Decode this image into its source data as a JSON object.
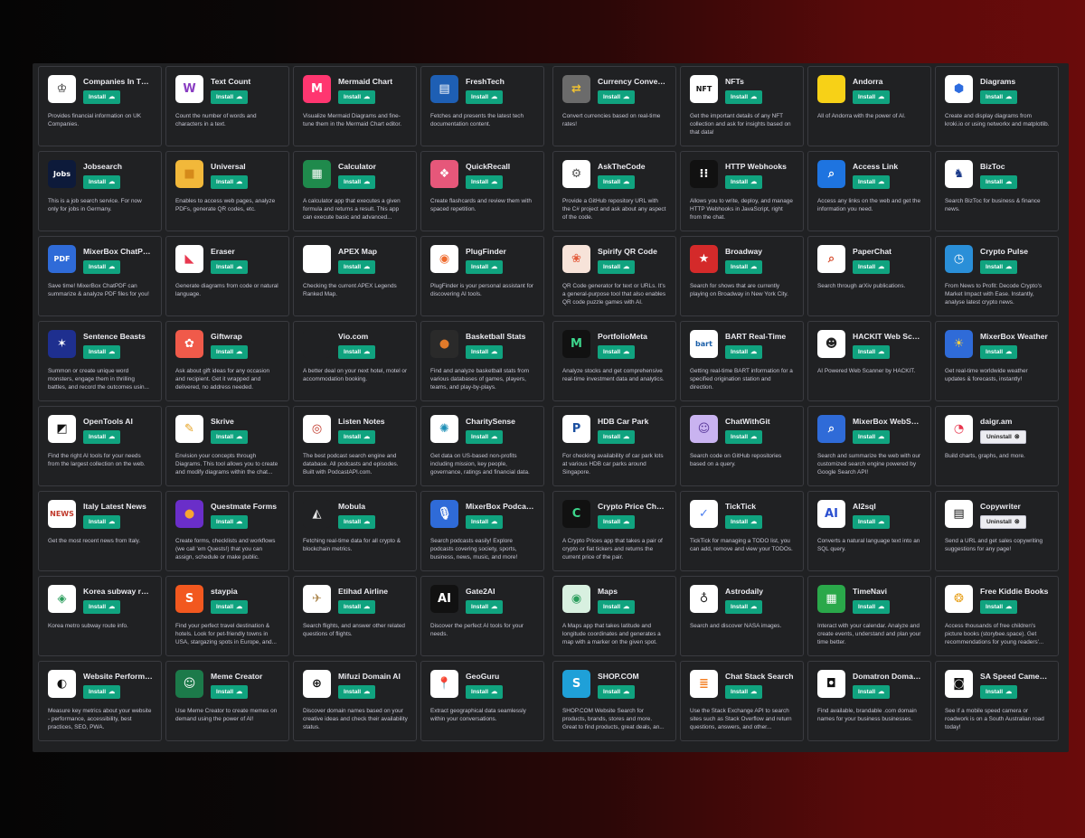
{
  "install_label": "Install",
  "uninstall_label": "Uninstall",
  "left_plugins": [
    {
      "name": "Companies In The ...",
      "desc": "Provides financial information on UK Companies.",
      "icon": "crown-icon",
      "glyph": "♔",
      "bg": "#ffffff",
      "fg": "#222222",
      "action": "install"
    },
    {
      "name": "Text Count",
      "desc": "Count the number of words and characters in a text.",
      "icon": "w-circle-icon",
      "glyph": "W",
      "bg": "#ffffff",
      "fg": "#8a3ec2",
      "action": "install"
    },
    {
      "name": "Mermaid Chart",
      "desc": "Visualize Mermaid Diagrams and fine-tune them in the Mermaid Chart editor.",
      "icon": "mermaid-icon",
      "glyph": "M",
      "bg": "#ff3670",
      "fg": "#ffffff",
      "action": "install"
    },
    {
      "name": "FreshTech",
      "desc": "Fetches and presents the latest tech documentation content.",
      "icon": "book-icon",
      "glyph": "▤",
      "bg": "#1e5fb4",
      "fg": "#ffffff",
      "action": "install"
    },
    {
      "name": "Jobsearch",
      "desc": "This is a job search service. For now only for jobs in Germany.",
      "icon": "jobs-icon",
      "glyph": "Jobs",
      "bg": "#0d1a3a",
      "fg": "#ffffff",
      "action": "install"
    },
    {
      "name": "Universal",
      "desc": "Enables to access web pages, analyze PDFs, generate QR codes, etc.",
      "icon": "cube-icon",
      "glyph": "■",
      "bg": "#f2b83a",
      "fg": "#d58a1a",
      "action": "install"
    },
    {
      "name": "Calculator",
      "desc": "A calculator app that executes a given formula and returns a result. This app can execute basic and advanced...",
      "icon": "calculator-icon",
      "glyph": "▦",
      "bg": "#1f8a4c",
      "fg": "#ffffff",
      "action": "install"
    },
    {
      "name": "QuickRecall",
      "desc": "Create flashcards and review them with spaced repetition.",
      "icon": "flashcard-icon",
      "glyph": "❖",
      "bg": "#e6577a",
      "fg": "#ffffff",
      "action": "install"
    },
    {
      "name": "MixerBox ChatPDF",
      "desc": "Save time! MixerBox ChatPDF can summarize & analyze PDF files for you!",
      "icon": "pdf-icon",
      "glyph": "PDF",
      "bg": "#2f6bd8",
      "fg": "#ffffff",
      "action": "install"
    },
    {
      "name": "Eraser",
      "desc": "Generate diagrams from code or natural language.",
      "icon": "eraser-icon",
      "glyph": "◣",
      "bg": "#ffffff",
      "fg": "#e8384f",
      "action": "install"
    },
    {
      "name": "APEX Map",
      "desc": "Checking the current APEX Legends Ranked Map.",
      "icon": "apex-map-icon",
      "glyph": "",
      "bg": "#ffffff",
      "fg": "#ffffff",
      "action": "install"
    },
    {
      "name": "PlugFinder",
      "desc": "PlugFinder is your personal assistant for discovering AI tools.",
      "icon": "plug-finder-icon",
      "glyph": "◉",
      "bg": "#ffffff",
      "fg": "#ef6c2f",
      "action": "install"
    },
    {
      "name": "Sentence Beasts",
      "desc": "Summon or create unique word monsters, engage them in thrilling battles, and record the outcomes usin...",
      "icon": "beasts-icon",
      "glyph": "✶",
      "bg": "#1e2f8f",
      "fg": "#ffffff",
      "action": "install"
    },
    {
      "name": "Giftwrap",
      "desc": "Ask about gift ideas for any occasion and recipient. Get it wrapped and delivered, no address needed.",
      "icon": "gift-icon",
      "glyph": "✿",
      "bg": "#f05a4a",
      "fg": "#ffffff",
      "action": "install"
    },
    {
      "name": "Vio.com",
      "desc": "A better deal on your next hotel, motel or accommodation booking.",
      "icon": "vio-icon",
      "glyph": "",
      "bg": "#202123",
      "fg": "#ffffff",
      "action": "install"
    },
    {
      "name": "Basketball Stats",
      "desc": "Find and analyze basketball stats from various databases of games, players, teams, and play-by-plays.",
      "icon": "basketball-icon",
      "glyph": "●",
      "bg": "#2a2a2a",
      "fg": "#e07a2a",
      "action": "install"
    },
    {
      "name": "OpenTools AI",
      "desc": "Find the right AI tools for your needs from the largest collection on the web.",
      "icon": "opentools-icon",
      "glyph": "◩",
      "bg": "#ffffff",
      "fg": "#111111",
      "action": "install"
    },
    {
      "name": "Skrive",
      "desc": "Envision your concepts through Diagrams. This tool allows you to create and modify diagrams within the chat...",
      "icon": "pencil-icon",
      "glyph": "✎",
      "bg": "#ffffff",
      "fg": "#e6a11f",
      "action": "install"
    },
    {
      "name": "Listen Notes",
      "desc": "The best podcast search engine and database. All podcasts and episodes. Built with PodcastAPI.com.",
      "icon": "listen-notes-icon",
      "glyph": "◎",
      "bg": "#ffffff",
      "fg": "#c0392b",
      "action": "install"
    },
    {
      "name": "CharitySense",
      "desc": "Get data on US-based non-profits including mission, key people, governance, ratings and financial data.",
      "icon": "charity-icon",
      "glyph": "✺",
      "bg": "#ffffff",
      "fg": "#1e8fb7",
      "action": "install"
    },
    {
      "name": "Italy Latest News",
      "desc": "Get the most recent news from Italy.",
      "icon": "italy-news-icon",
      "glyph": "NEWS",
      "bg": "#ffffff",
      "fg": "#c0392b",
      "action": "install"
    },
    {
      "name": "Questmate Forms",
      "desc": "Create forms, checklists and workflows (we call 'em Quests!) that you can assign, schedule or make public.",
      "icon": "questmate-icon",
      "glyph": "●",
      "bg": "#6a2ec9",
      "fg": "#f7a531",
      "action": "install"
    },
    {
      "name": "Mobula",
      "desc": "Fetching real-time data for all crypto & blockchain metrics.",
      "icon": "mobula-icon",
      "glyph": "◭",
      "bg": "#202123",
      "fg": "#e8e8e8",
      "action": "install"
    },
    {
      "name": "MixerBox Podcasts",
      "desc": "Search podcasts easily! Explore podcasts covering society, sports, business, news, music, and more!",
      "icon": "podcast-icon",
      "glyph": "🎙",
      "bg": "#2f6bd8",
      "fg": "#ffffff",
      "action": "install"
    },
    {
      "name": "Korea subway route",
      "desc": "Korea metro subway route info.",
      "icon": "subway-icon",
      "glyph": "◈",
      "bg": "#ffffff",
      "fg": "#2a9d5c",
      "action": "install"
    },
    {
      "name": "staypia",
      "desc": "Find your perfect travel destination & hotels. Look for pet-friendly towns in USA, stargazing spots in Europe, and...",
      "icon": "staypia-icon",
      "glyph": "S",
      "bg": "#f2581f",
      "fg": "#ffffff",
      "action": "install"
    },
    {
      "name": "Etihad Airline",
      "desc": "Search flights, and answer other related questions of flights.",
      "icon": "etihad-icon",
      "glyph": "✈",
      "bg": "#ffffff",
      "fg": "#b08d57",
      "action": "install"
    },
    {
      "name": "Gate2AI",
      "desc": "Discover the perfect AI tools for your needs.",
      "icon": "gate2ai-icon",
      "glyph": "AI",
      "bg": "#111111",
      "fg": "#ffffff",
      "action": "install"
    },
    {
      "name": "Website Performa...",
      "desc": "Measure key metrics about your website - performance, accessibility, best practices, SEO, PWA.",
      "icon": "speedometer-icon",
      "glyph": "◐",
      "bg": "#ffffff",
      "fg": "#111111",
      "action": "install"
    },
    {
      "name": "Meme Creator",
      "desc": "Use Meme Creator to create memes on demand using the power of AI!",
      "icon": "meme-icon",
      "glyph": "☺",
      "bg": "#1c7a4a",
      "fg": "#ffffff",
      "action": "install"
    },
    {
      "name": "Mifuzi Domain AI",
      "desc": "Discover domain names based on your creative ideas and check their availability status.",
      "icon": "globe-www-icon",
      "glyph": "⊕",
      "bg": "#ffffff",
      "fg": "#111111",
      "action": "install"
    },
    {
      "name": "GeoGuru",
      "desc": "Extract geographical data seamlessly within your conversations.",
      "icon": "pin-icon",
      "glyph": "📍",
      "bg": "#ffffff",
      "fg": "#d0322f",
      "action": "install"
    }
  ],
  "right_plugins": [
    {
      "name": "Currency Converter",
      "desc": "Convert currencies based on real-time rates!",
      "icon": "currency-icon",
      "glyph": "⇄",
      "bg": "#6b6b6b",
      "fg": "#f1c232",
      "action": "install"
    },
    {
      "name": "NFTs",
      "desc": "Get the important details of any NFT collection and ask for insights based on that data!",
      "icon": "nft-icon",
      "glyph": "NFT",
      "bg": "#ffffff",
      "fg": "#111111",
      "action": "install"
    },
    {
      "name": "Andorra",
      "desc": "All of Andorra with the power of AI.",
      "icon": "andorra-flag-icon",
      "glyph": "",
      "bg": "#f7d117",
      "fg": "#d0103a",
      "action": "install"
    },
    {
      "name": "Diagrams",
      "desc": "Create and display diagrams from kroki.io or using networkx and matplotlib.",
      "icon": "diagrams-icon",
      "glyph": "⬢",
      "bg": "#ffffff",
      "fg": "#2d6cdf",
      "action": "install"
    },
    {
      "name": "AskTheCode",
      "desc": "Provide a GitHub repository URL with the C# project and ask about any aspect of the code.",
      "icon": "askthecode-icon",
      "glyph": "⚙",
      "bg": "#ffffff",
      "fg": "#555555",
      "action": "install"
    },
    {
      "name": "HTTP Webhooks",
      "desc": "Allows you to write, deploy, and manage HTTP Webhooks in JavaScript, right from the chat.",
      "icon": "webhooks-icon",
      "glyph": "⁝⁝",
      "bg": "#111111",
      "fg": "#ffffff",
      "action": "install"
    },
    {
      "name": "Access Link",
      "desc": "Access any links on the web and get the information you need.",
      "icon": "access-link-icon",
      "glyph": "⌕",
      "bg": "#1e74e0",
      "fg": "#ffffff",
      "action": "install"
    },
    {
      "name": "BizToc",
      "desc": "Search BizToc for business & finance news.",
      "icon": "biztoc-icon",
      "glyph": "♞",
      "bg": "#ffffff",
      "fg": "#1b3a8a",
      "action": "install"
    },
    {
      "name": "Spirify QR Code",
      "desc": "QR Code generator for text or URLs. It's a general-purpose tool that also enables QR code puzzle games with AI.",
      "icon": "spirify-icon",
      "glyph": "❀",
      "bg": "#f7e3d9",
      "fg": "#e35a3a",
      "action": "install"
    },
    {
      "name": "Broadway",
      "desc": "Search for shows that are currently playing on Broadway in New York City.",
      "icon": "broadway-star-icon",
      "glyph": "★",
      "bg": "#d42a2a",
      "fg": "#ffffff",
      "action": "install"
    },
    {
      "name": "PaperChat",
      "desc": "Search through arXiv publications.",
      "icon": "paperchat-icon",
      "glyph": "⌕",
      "bg": "#ffffff",
      "fg": "#d64a2a",
      "action": "install"
    },
    {
      "name": "Crypto Pulse",
      "desc": "From News to Profit: Decode Crypto's Market Impact with Ease. Instantly, analyse latest crypto news.",
      "icon": "crypto-pulse-icon",
      "glyph": "◷",
      "bg": "#2a8fd8",
      "fg": "#ffffff",
      "action": "install"
    },
    {
      "name": "PortfolioMeta",
      "desc": "Analyze stocks and get comprehensive real-time investment data and analytics.",
      "icon": "portfoliometa-icon",
      "glyph": "M",
      "bg": "#111111",
      "fg": "#3dd68c",
      "action": "install"
    },
    {
      "name": "BART Real-Time",
      "desc": "Getting real-time BART information for a specified origination station and direction.",
      "icon": "bart-icon",
      "glyph": "bart",
      "bg": "#ffffff",
      "fg": "#1a5ea8",
      "action": "install"
    },
    {
      "name": "HACKIT Web Scan...",
      "desc": "AI Powered Web Scanner by HACKIT.",
      "icon": "hackit-icon",
      "glyph": "☻",
      "bg": "#ffffff",
      "fg": "#222222",
      "action": "install"
    },
    {
      "name": "MixerBox Weather",
      "desc": "Get real-time worldwide weather updates & forecasts, instantly!",
      "icon": "weather-icon",
      "glyph": "☀",
      "bg": "#2f6bd8",
      "fg": "#ffd23f",
      "action": "install"
    },
    {
      "name": "HDB Car Park",
      "desc": "For checking availability of car park lots at various HDB car parks around Singapore.",
      "icon": "car-park-icon",
      "glyph": "P",
      "bg": "#ffffff",
      "fg": "#1a4fa0",
      "action": "install"
    },
    {
      "name": "ChatWithGit",
      "desc": "Search code on GitHub repositories based on a query.",
      "icon": "chatwithgit-icon",
      "glyph": "☺",
      "bg": "#c9b3f0",
      "fg": "#5a3a9a",
      "action": "install"
    },
    {
      "name": "MixerBox WebSear...",
      "desc": "Search and summarize the web with our customized search engine powered by Google Search API!",
      "icon": "websearch-icon",
      "glyph": "⌕",
      "bg": "#2f6bd8",
      "fg": "#ffffff",
      "action": "install"
    },
    {
      "name": "daigr.am",
      "desc": "Build charts, graphs, and more.",
      "icon": "daigram-icon",
      "glyph": "◔",
      "bg": "#ffffff",
      "fg": "#e8384f",
      "action": "uninstall"
    },
    {
      "name": "Crypto Price Chec...",
      "desc": "A Crypto Prices app that takes a pair of crypto or fiat tickers and returns the current price of the pair.",
      "icon": "crypto-price-icon",
      "glyph": "C",
      "bg": "#111111",
      "fg": "#3dd68c",
      "action": "install"
    },
    {
      "name": "TickTick",
      "desc": "TickTick for managing a TODO list, you can add, remove and view your TODOs.",
      "icon": "ticktick-icon",
      "glyph": "✓",
      "bg": "#ffffff",
      "fg": "#4a7ef0",
      "action": "install"
    },
    {
      "name": "AI2sql",
      "desc": "Converts a natural language text into an SQL query.",
      "icon": "ai2sql-icon",
      "glyph": "AI",
      "bg": "#ffffff",
      "fg": "#2a4fd0",
      "action": "install"
    },
    {
      "name": "Copywriter",
      "desc": "Send a URL and get sales copywriting suggestions for any page!",
      "icon": "copywriter-icon",
      "glyph": "▤",
      "bg": "#ffffff",
      "fg": "#111111",
      "action": "uninstall"
    },
    {
      "name": "Maps",
      "desc": "A Maps app that takes latitude and longitude coordinates and generates a map with a marker on the given spot.",
      "icon": "maps-icon",
      "glyph": "◉",
      "bg": "#d8f0e0",
      "fg": "#2a9d5c",
      "action": "install"
    },
    {
      "name": "Astrodaily",
      "desc": "Search and discover NASA images.",
      "icon": "astro-icon",
      "glyph": "♁",
      "bg": "#ffffff",
      "fg": "#222222",
      "action": "install"
    },
    {
      "name": "TimeNavi",
      "desc": "Interact with your calendar. Analyze and create events, understand and plan your time better.",
      "icon": "calendar-icon",
      "glyph": "▦",
      "bg": "#2aa84a",
      "fg": "#ffffff",
      "action": "install"
    },
    {
      "name": "Free Kiddie Books",
      "desc": "Access thousands of free children's picture books (storybee.space). Get recommendations for young readers'...",
      "icon": "kiddie-books-icon",
      "glyph": "❂",
      "bg": "#ffffff",
      "fg": "#e8a21f",
      "action": "install"
    },
    {
      "name": "SHOP.COM",
      "desc": "SHOP.COM Website Search for products, brands, stores and more. Great to find products, great deals, an...",
      "icon": "shopcom-icon",
      "glyph": "S",
      "bg": "#1fa0d8",
      "fg": "#ffffff",
      "action": "install"
    },
    {
      "name": "Chat Stack Search",
      "desc": "Use the Stack Exchange API to search sites such as Stack Overflow and return questions, answers, and other...",
      "icon": "stack-icon",
      "glyph": "≣",
      "bg": "#ffffff",
      "fg": "#f48024",
      "action": "install"
    },
    {
      "name": "Domatron Domains",
      "desc": "Find available, brandable .com domain names for your business businesses.",
      "icon": "domatron-icon",
      "glyph": "◘",
      "bg": "#ffffff",
      "fg": "#111111",
      "action": "install"
    },
    {
      "name": "SA Speed Cameras",
      "desc": "See if a mobile speed camera or roadwork is on a South Australian road today!",
      "icon": "speed-camera-icon",
      "glyph": "◙",
      "bg": "#ffffff",
      "fg": "#111111",
      "action": "install"
    }
  ]
}
